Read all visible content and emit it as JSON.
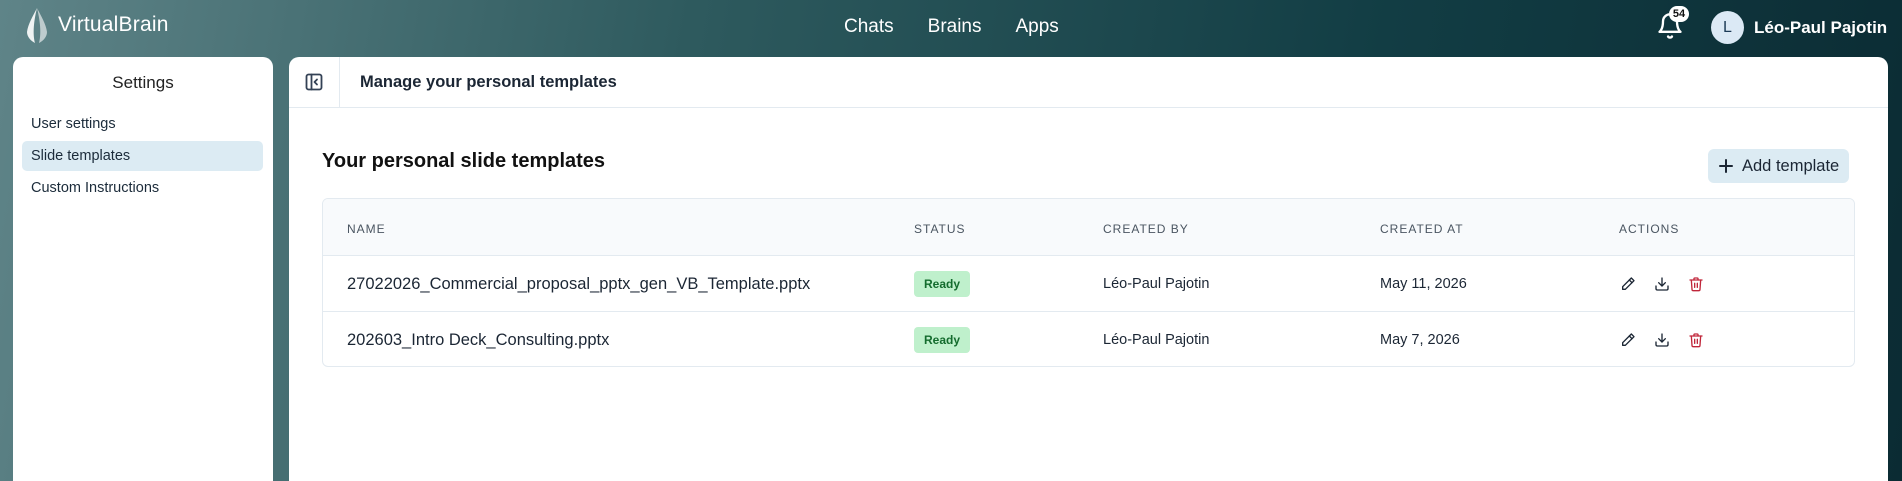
{
  "app": {
    "name": "VirtualBrain"
  },
  "nav": {
    "items": [
      {
        "label": "Chats"
      },
      {
        "label": "Brains"
      },
      {
        "label": "Apps"
      }
    ]
  },
  "notifications": {
    "count": "54"
  },
  "user": {
    "initial": "L",
    "name": "Léo-Paul Pajotin"
  },
  "sidebar": {
    "title": "Settings",
    "items": [
      {
        "label": "User settings",
        "active": false
      },
      {
        "label": "Slide templates",
        "active": true
      },
      {
        "label": "Custom Instructions",
        "active": false
      }
    ]
  },
  "main": {
    "header_title": "Manage your personal templates",
    "section_title": "Your personal slide templates",
    "add_button_label": "Add template"
  },
  "table": {
    "columns": [
      "NAME",
      "STATUS",
      "CREATED BY",
      "CREATED AT",
      "ACTIONS"
    ],
    "rows": [
      {
        "name": "27022026_Commercial_proposal_pptx_gen_VB_Template.pptx",
        "status": "Ready",
        "created_by": "Léo-Paul Pajotin",
        "created_at": "May 11, 2026"
      },
      {
        "name": "202603_Intro Deck_Consulting.pptx",
        "status": "Ready",
        "created_by": "Léo-Paul Pajotin",
        "created_at": "May 7, 2026"
      }
    ]
  },
  "colors": {
    "accent_light": "#dcebf3",
    "status_ready_bg": "#bff0cc",
    "status_ready_text": "#146c2e",
    "delete": "#c0263a"
  },
  "icons": [
    "logo-icon",
    "bell-icon",
    "sidebar-toggle-icon",
    "plus-icon",
    "pencil-icon",
    "download-icon",
    "trash-icon"
  ]
}
